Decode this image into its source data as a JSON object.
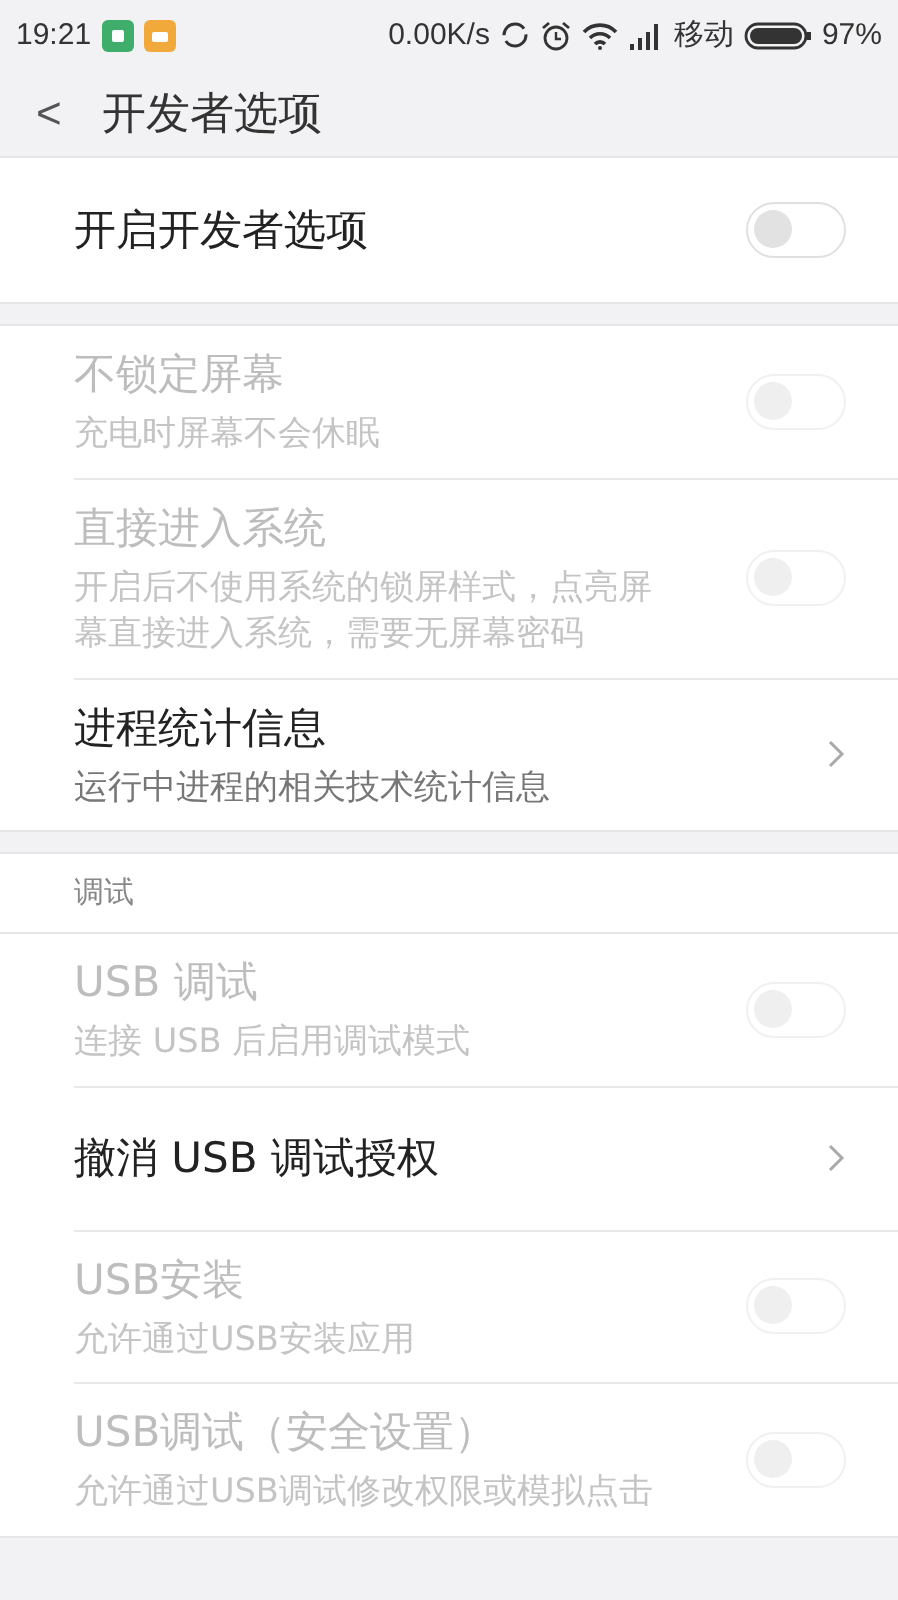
{
  "status_bar": {
    "time": "19:21",
    "speed": "0.00K/s",
    "carrier": "移动",
    "battery": "97%"
  },
  "header": {
    "back": "<",
    "title": "开发者选项"
  },
  "sections": [
    {
      "items": [
        {
          "kind": "toggle",
          "title": "开启开发者选项",
          "on": false,
          "disabled": false
        }
      ]
    },
    {
      "items": [
        {
          "kind": "toggle",
          "title": "不锁定屏幕",
          "subtitle": "充电时屏幕不会休眠",
          "on": false,
          "disabled": true
        },
        {
          "kind": "toggle",
          "title": "直接进入系统",
          "subtitle": "开启后不使用系统的锁屏样式，点亮屏幕直接进入系统，需要无屏幕密码",
          "on": false,
          "disabled": true
        },
        {
          "kind": "link",
          "title": "进程统计信息",
          "subtitle": "运行中进程的相关技术统计信息",
          "disabled": false
        }
      ]
    },
    {
      "heading": "调试",
      "items": [
        {
          "kind": "toggle",
          "title": "USB 调试",
          "subtitle": "连接 USB 后启用调试模式",
          "on": false,
          "disabled": true
        },
        {
          "kind": "link",
          "title": "撤消 USB 调试授权",
          "disabled": false
        },
        {
          "kind": "toggle",
          "title": "USB安装",
          "subtitle": "允许通过USB安装应用",
          "on": false,
          "disabled": true
        },
        {
          "kind": "toggle",
          "title": "USB调试（安全设置）",
          "subtitle": "允许通过USB调试修改权限或模拟点击",
          "on": false,
          "disabled": true
        }
      ]
    }
  ]
}
